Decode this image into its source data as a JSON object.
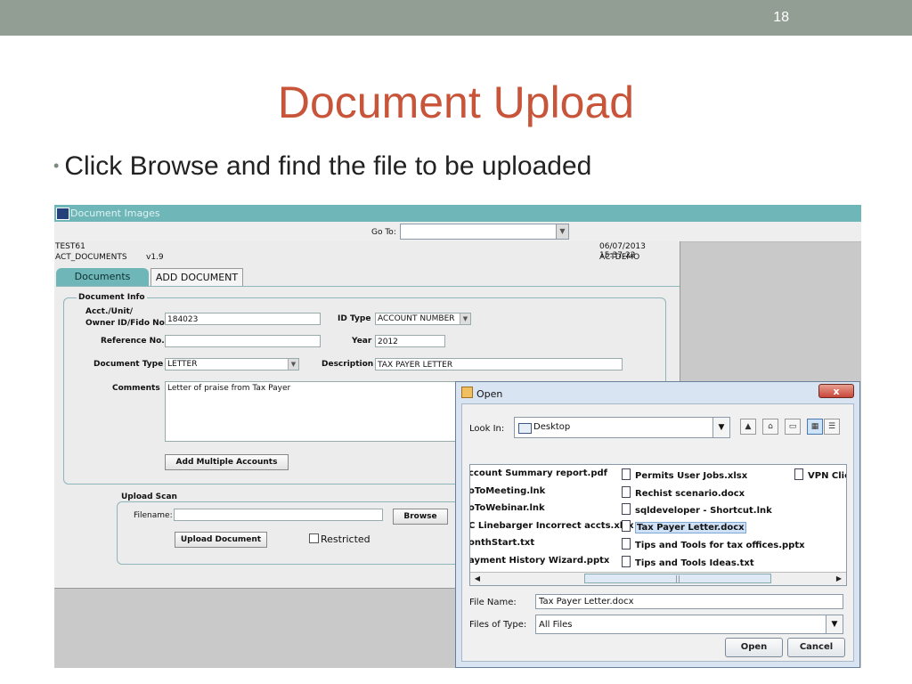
{
  "slide": {
    "number": "18",
    "title": "Document Upload",
    "bullet": "Click Browse and find the file to be uploaded"
  },
  "app": {
    "window_title": "Document Images",
    "goto_label": "Go To:",
    "user": "TEST61",
    "module": "ACT_DOCUMENTS",
    "version": "v1.9",
    "datetime": "06/07/2013 15:37:22",
    "env": "ACTDEMO",
    "tabs": [
      "Documents",
      "ADD DOCUMENT"
    ]
  },
  "doc_info": {
    "group_label": "Document Info",
    "acct_label_1": "Acct./Unit/",
    "acct_label_2": "Owner ID/Fido No.",
    "acct_value": "184023",
    "id_type_label": "ID Type",
    "id_type_value": "ACCOUNT NUMBER",
    "ref_label": "Reference No.",
    "ref_value": "",
    "year_label": "Year",
    "year_value": "2012",
    "doc_type_label": "Document Type",
    "doc_type_value": "LETTER",
    "desc_label": "Description",
    "desc_value": "TAX PAYER LETTER",
    "comments_label": "Comments",
    "comments_value": "Letter of praise from Tax Payer",
    "add_multi_button": "Add Multiple Accounts"
  },
  "upload": {
    "group_label": "Upload Scan",
    "filename_label": "Filename:",
    "filename_value": "",
    "browse_button": "Browse",
    "upload_button": "Upload Document",
    "restricted_label": "Restricted"
  },
  "open_dialog": {
    "title": "Open",
    "close_glyph": "x",
    "look_in_label": "Look In:",
    "look_in_value": "Desktop",
    "files": {
      "col1": [
        "ccount Summary report.pdf",
        "oToMeeting.lnk",
        "oToWebinar.lnk",
        "C Linebarger Incorrect accts.xlsx",
        "onthStart.txt",
        "ayment History Wizard.pptx"
      ],
      "col2": [
        "Permits User Jobs.xlsx",
        "Rechist scenario.docx",
        "sqldeveloper - Shortcut.lnk",
        "Tax Payer Letter.docx",
        "Tips and Tools for tax offices.pptx",
        "Tips and Tools Ideas.txt"
      ],
      "col3": [
        "VPN Clie"
      ]
    },
    "selected_file": "Tax Payer Letter.docx",
    "file_name_label": "File Name:",
    "file_name_value": "Tax Payer Letter.docx",
    "files_of_type_label": "Files of Type:",
    "files_of_type_value": "All Files",
    "open_button": "Open",
    "cancel_button": "Cancel"
  },
  "colors": {
    "title": "#c8553a",
    "topbar": "#929e94",
    "window_title_bar": "#6fb6b8",
    "dialog_frame": "#d8e4f2",
    "close_button": "#c8453a"
  }
}
